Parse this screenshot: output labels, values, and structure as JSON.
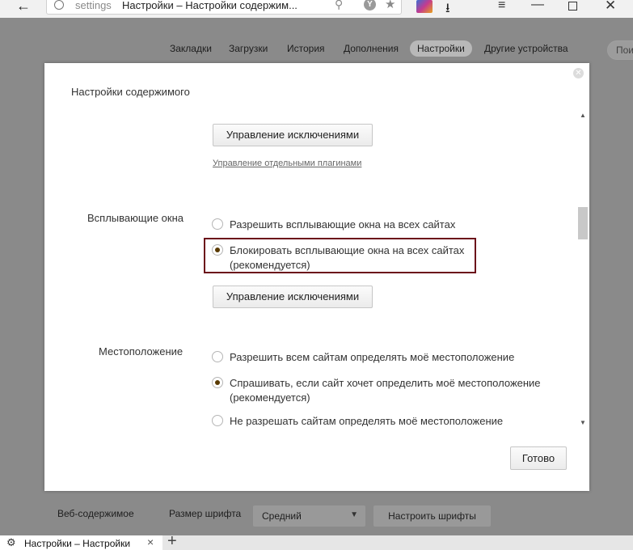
{
  "browser": {
    "address_host": "settings",
    "address_title": "Настройки – Настройки содержим...",
    "yandex_badge": "Y"
  },
  "page_tabs": [
    {
      "label": "Закладки",
      "active": false
    },
    {
      "label": "Загрузки",
      "active": false
    },
    {
      "label": "История",
      "active": false
    },
    {
      "label": "Дополнения",
      "active": false
    },
    {
      "label": "Настройки",
      "active": true
    },
    {
      "label": "Другие устройства",
      "active": false
    }
  ],
  "page_search_placeholder": "Пои",
  "background_row": {
    "label": "Веб-содержимое",
    "font_size_label": "Размер шрифта",
    "font_size_value": "Средний",
    "font_button": "Настроить шрифты"
  },
  "dialog": {
    "title": "Настройки содержимого",
    "plugins_exceptions_button": "Управление исключениями",
    "plugins_link": "Управление отдельными плагинами",
    "popups": {
      "label": "Всплывающие окна",
      "options": [
        {
          "label": "Разрешить всплывающие окна на всех сайтах",
          "checked": false
        },
        {
          "label": "Блокировать всплывающие окна на всех сайтах",
          "label2": "(рекомендуется)",
          "checked": true
        }
      ],
      "exceptions_button": "Управление исключениями"
    },
    "location": {
      "label": "Местоположение",
      "options": [
        {
          "label": "Разрешить всем сайтам определять моё местоположение",
          "checked": false
        },
        {
          "label": "Спрашивать, если сайт хочет определить моё местоположение",
          "label2": "(рекомендуется)",
          "checked": true
        },
        {
          "label": "Не разрешать сайтам определять моё местоположение",
          "checked": false
        }
      ]
    },
    "done_button": "Готово"
  },
  "bottom_tab": {
    "title": "Настройки – Настройки"
  },
  "colors": {
    "highlight_border": "#6b0f1a",
    "overlay": "#8a8a8a"
  }
}
